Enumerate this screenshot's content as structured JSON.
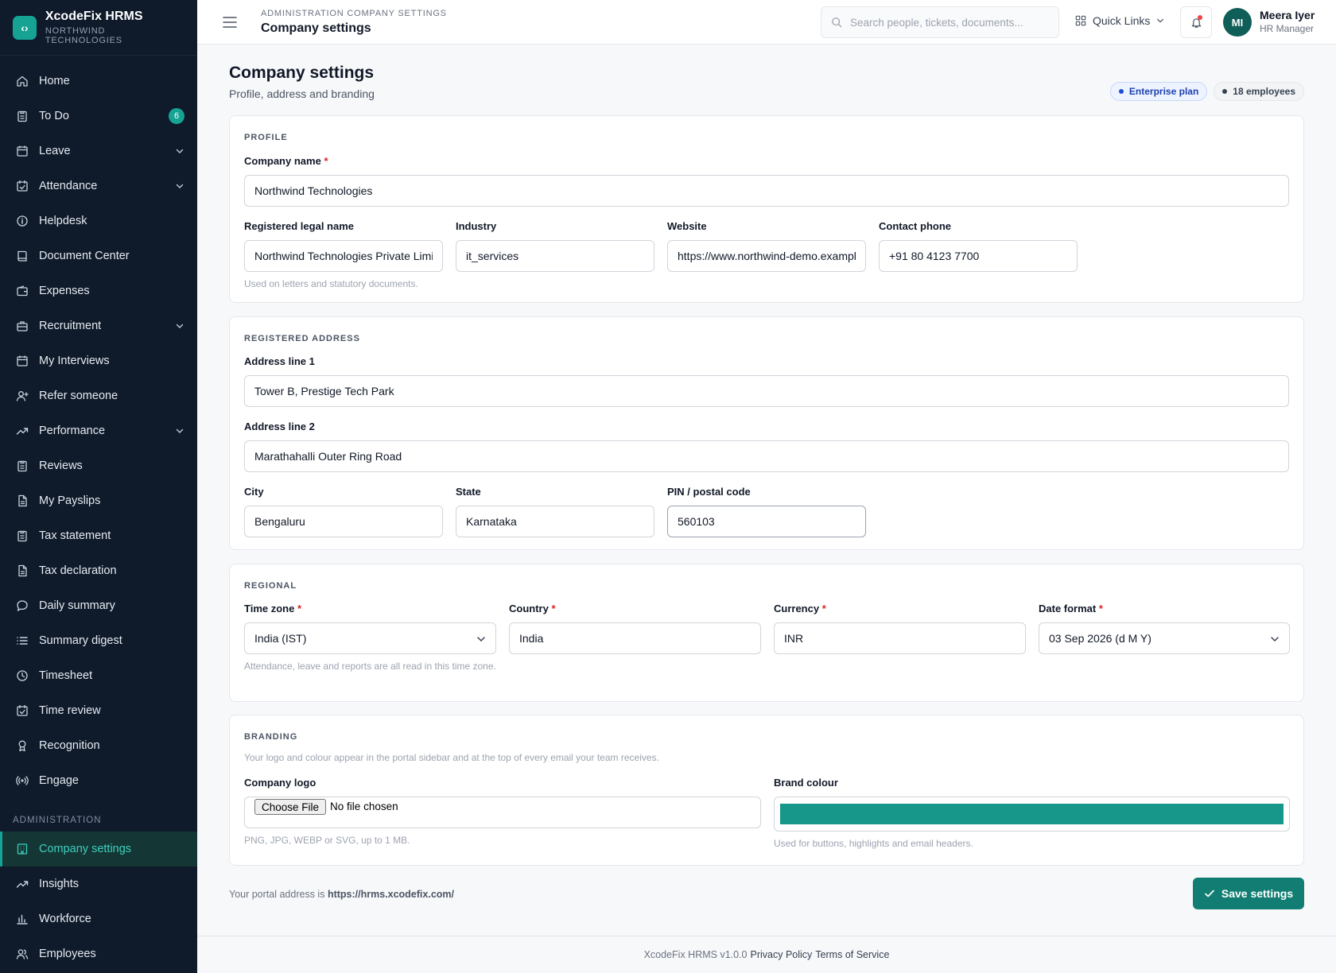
{
  "brand": {
    "logo_glyph": "‹›",
    "title": "XcodeFix HRMS",
    "subtitle": "NORTHWIND TECHNOLOGIES",
    "accent_color": "#16a394"
  },
  "sidebar": {
    "items": [
      {
        "label": "Home",
        "icon": "home-icon"
      },
      {
        "label": "To Do",
        "icon": "clipboard-icon",
        "badge": "6"
      },
      {
        "label": "Leave",
        "icon": "calendar-icon",
        "expandable": true
      },
      {
        "label": "Attendance",
        "icon": "calendar-check-icon",
        "expandable": true
      },
      {
        "label": "Helpdesk",
        "icon": "info-icon"
      },
      {
        "label": "Document Center",
        "icon": "book-icon"
      },
      {
        "label": "Expenses",
        "icon": "wallet-icon"
      },
      {
        "label": "Recruitment",
        "icon": "briefcase-icon",
        "expandable": true
      },
      {
        "label": "My Interviews",
        "icon": "calendar-icon"
      },
      {
        "label": "Refer someone",
        "icon": "user-plus-icon"
      },
      {
        "label": "Performance",
        "icon": "trend-icon",
        "expandable": true
      },
      {
        "label": "Reviews",
        "icon": "clipboard-icon"
      },
      {
        "label": "My Payslips",
        "icon": "file-icon"
      },
      {
        "label": "Tax statement",
        "icon": "clipboard-icon"
      },
      {
        "label": "Tax declaration",
        "icon": "file-icon"
      },
      {
        "label": "Daily summary",
        "icon": "chat-icon"
      },
      {
        "label": "Summary digest",
        "icon": "list-icon"
      },
      {
        "label": "Timesheet",
        "icon": "clock-icon"
      },
      {
        "label": "Time review",
        "icon": "calendar-check-icon"
      },
      {
        "label": "Recognition",
        "icon": "award-icon"
      },
      {
        "label": "Engage",
        "icon": "broadcast-icon"
      }
    ],
    "admin_section": "ADMINISTRATION",
    "admin_items": [
      {
        "label": "Company settings",
        "icon": "building-icon",
        "active": true
      },
      {
        "label": "Insights",
        "icon": "trend-icon"
      },
      {
        "label": "Workforce",
        "icon": "bar-chart-icon"
      },
      {
        "label": "Employees",
        "icon": "users-icon"
      }
    ]
  },
  "header": {
    "breadcrumb": "ADMINISTRATION COMPANY SETTINGS",
    "title": "Company settings",
    "search_placeholder": "Search people, tickets, documents...",
    "quick_links": "Quick Links",
    "user_initials": "MI",
    "user_name": "Meera Iyer",
    "user_role": "HR Manager"
  },
  "page": {
    "title": "Company settings",
    "subtitle": "Profile, address and branding",
    "plan_pill": "Enterprise plan",
    "employees_pill": "18 employees"
  },
  "profile": {
    "section": "PROFILE",
    "company_name_label": "Company name",
    "company_name": "Northwind Technologies",
    "legal_name_label": "Registered legal name",
    "legal_name": "Northwind Technologies Private Limited",
    "legal_help": "Used on letters and statutory documents.",
    "industry_label": "Industry",
    "industry": "it_services",
    "website_label": "Website",
    "website": "https://www.northwind-demo.example.com",
    "phone_label": "Contact phone",
    "phone": "+91 80 4123 7700"
  },
  "address": {
    "section": "REGISTERED ADDRESS",
    "line1_label": "Address line 1",
    "line1": "Tower B, Prestige Tech Park",
    "line2_label": "Address line 2",
    "line2": "Marathahalli Outer Ring Road",
    "city_label": "City",
    "city": "Bengaluru",
    "state_label": "State",
    "state": "Karnataka",
    "pin_label": "PIN / postal code",
    "pin": "560103"
  },
  "regional": {
    "section": "REGIONAL",
    "timezone_label": "Time zone",
    "timezone": "India (IST)",
    "timezone_help": "Attendance, leave and reports are all read in this time zone.",
    "country_label": "Country",
    "country": "India",
    "currency_label": "Currency",
    "currency": "INR",
    "date_format_label": "Date format",
    "date_format": "03 Sep 2026 (d M Y)"
  },
  "branding": {
    "section": "BRANDING",
    "description": "Your logo and colour appear in the portal sidebar and at the top of every email your team receives.",
    "logo_label": "Company logo",
    "file_button": "Choose File",
    "file_status": "No file chosen",
    "logo_help": "PNG, JPG, WEBP or SVG, up to 1 MB.",
    "colour_label": "Brand colour",
    "colour_value": "#16978a",
    "colour_help": "Used for buttons, highlights and email headers."
  },
  "actions": {
    "portal_prefix": "Your portal address is",
    "portal_url": "https://hrms.xcodefix.com/",
    "save_label": "Save settings"
  },
  "footer": {
    "version": "XcodeFix HRMS v1.0.0",
    "privacy": "Privacy Policy",
    "terms": "Terms of Service"
  }
}
